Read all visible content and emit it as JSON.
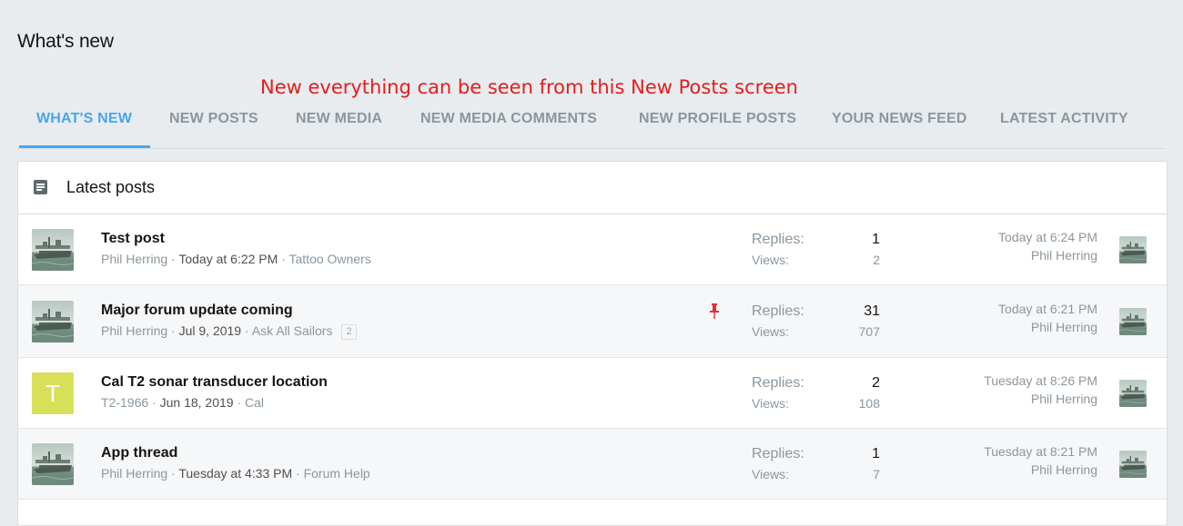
{
  "page": {
    "title": "What's new"
  },
  "annotation": "New everything can be seen from this New Posts screen",
  "tabs": [
    {
      "label": "What's new",
      "active": true
    },
    {
      "label": "New posts"
    },
    {
      "label": "New media"
    },
    {
      "label": "New media comments"
    },
    {
      "label": "New profile posts"
    },
    {
      "label": "Your news feed"
    },
    {
      "label": "Latest activity"
    }
  ],
  "block": {
    "title": "Latest posts",
    "icon": "list-icon"
  },
  "labels": {
    "replies": "Replies:",
    "views": "Views:"
  },
  "threads": [
    {
      "title": "Test post",
      "author": "Phil Herring",
      "date": "Today at 6:22 PM",
      "forum": "Tattoo Owners",
      "replies": "1",
      "views": "2",
      "last_date": "Today at 6:24 PM",
      "last_user": "Phil Herring",
      "avatar": "ship-avatar"
    },
    {
      "title": "Major forum update coming",
      "author": "Phil Herring",
      "date": "Jul 9, 2019",
      "forum": "Ask All Sailors",
      "page_badge": "2",
      "pinned": true,
      "replies": "31",
      "views": "707",
      "last_date": "Today at 6:21 PM",
      "last_user": "Phil Herring",
      "avatar": "ship-avatar"
    },
    {
      "title": "Cal T2 sonar transducer location",
      "author": "T2-1966",
      "date": "Jun 18, 2019",
      "forum": "Cal",
      "replies": "2",
      "views": "108",
      "last_date": "Tuesday at 8:26 PM",
      "last_user": "Phil Herring",
      "avatar_letter": "T",
      "avatar_color": "#d8e05a"
    },
    {
      "title": "App thread",
      "author": "Phil Herring",
      "date": "Tuesday at 4:33 PM",
      "forum": "Forum Help",
      "replies": "1",
      "views": "7",
      "last_date": "Tuesday at 8:21 PM",
      "last_user": "Phil Herring",
      "avatar": "ship-avatar"
    }
  ],
  "colors": {
    "accent": "#47a7eb",
    "annotation": "#e51c1c",
    "muted": "#8a979f",
    "pin": "#e03030"
  }
}
